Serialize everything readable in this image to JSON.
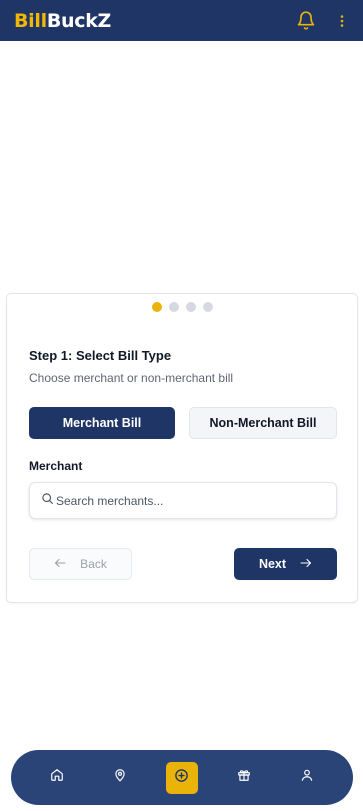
{
  "header": {
    "logo_part1": "Bill",
    "logo_part2": "BuckZ",
    "colors": {
      "bar": "#1e3566",
      "logo_accent": "#f2b705",
      "bell": "#eab308"
    }
  },
  "wizard": {
    "steps_total": 4,
    "current_step": 1,
    "title": "Step 1: Select Bill Type",
    "subtitle": "Choose merchant or non-merchant bill",
    "bill_types": {
      "merchant_label": "Merchant Bill",
      "non_merchant_label": "Non-Merchant Bill",
      "selected": "Merchant Bill"
    },
    "merchant_field": {
      "label": "Merchant",
      "placeholder": "Search merchants...",
      "value": ""
    },
    "back_label": "Back",
    "next_label": "Next"
  },
  "bottom_nav": {
    "items": [
      {
        "name": "home",
        "icon": "home-icon"
      },
      {
        "name": "locations",
        "icon": "map-pin-icon"
      },
      {
        "name": "add",
        "icon": "plus-circle-icon",
        "active": true
      },
      {
        "name": "rewards",
        "icon": "gift-icon"
      },
      {
        "name": "profile",
        "icon": "user-icon"
      }
    ],
    "colors": {
      "bar": "#2a4478",
      "active": "#eab308"
    }
  }
}
